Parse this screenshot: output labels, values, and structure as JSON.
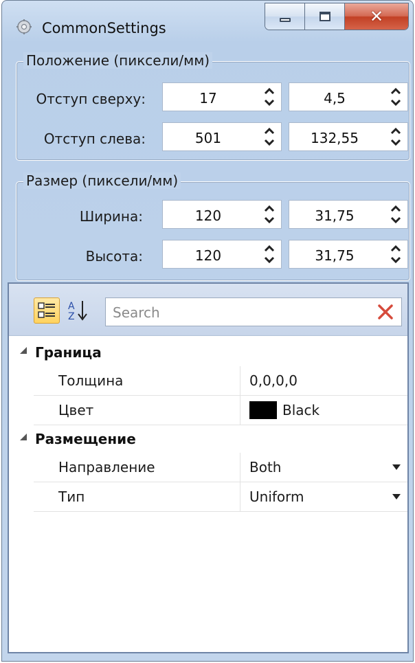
{
  "window": {
    "title": "CommonSettings",
    "buttons": {
      "minimize": "minimize",
      "maximize": "maximize",
      "close": "close"
    }
  },
  "position_group": {
    "legend": "Положение (пиксели/мм)",
    "rows": [
      {
        "label": "Отступ сверху:",
        "px": "17",
        "mm": "4,5"
      },
      {
        "label": "Отступ слева:",
        "px": "501",
        "mm": "132,55"
      }
    ]
  },
  "size_group": {
    "legend": "Размер (пиксели/мм)",
    "rows": [
      {
        "label": "Ширина:",
        "px": "120",
        "mm": "31,75"
      },
      {
        "label": "Высота:",
        "px": "120",
        "mm": "31,75"
      }
    ]
  },
  "property_grid": {
    "search_placeholder": "Search",
    "categories": [
      {
        "name": "Граница",
        "properties": [
          {
            "name": "Толщина",
            "value": "0,0,0,0"
          },
          {
            "name": "Цвет",
            "value": "Black",
            "swatch": "#000000"
          }
        ]
      },
      {
        "name": "Размещение",
        "properties": [
          {
            "name": "Направление",
            "value": "Both",
            "dropdown": true
          },
          {
            "name": "Тип",
            "value": "Uniform",
            "dropdown": true
          }
        ]
      }
    ]
  },
  "colors": {
    "accent": "#c24024",
    "panel": "#c2d5ec",
    "highlight": "#ffd35f"
  }
}
